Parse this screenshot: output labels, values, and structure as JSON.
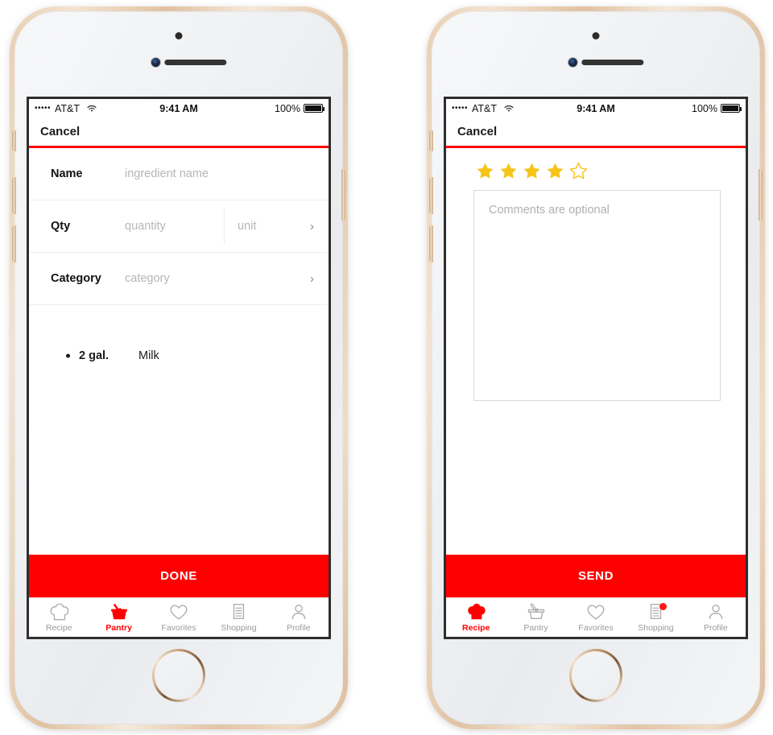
{
  "theme": {
    "accent": "#ff0000",
    "star_color": "#f5c518",
    "muted_text": "#9a9a9a",
    "placeholder": "#b6b6b6"
  },
  "status_bar": {
    "signal_dots": "•••••",
    "carrier": "AT&T",
    "wifi_icon": "wifi-icon",
    "time": "9:41 AM",
    "battery_percent": "100%",
    "battery_icon": "battery-full-icon"
  },
  "phones": [
    {
      "id": "add-ingredient",
      "nav": {
        "cancel_label": "Cancel"
      },
      "form": {
        "rows": [
          {
            "label": "Name",
            "placeholder": "ingredient name",
            "has_chevron": false,
            "split": null
          },
          {
            "label": "Qty",
            "placeholder": "quantity",
            "has_chevron": true,
            "split": {
              "placeholder": "unit"
            }
          },
          {
            "label": "Category",
            "placeholder": "category",
            "has_chevron": true,
            "split": null
          }
        ],
        "chevron_glyph": "›"
      },
      "ingredients": [
        {
          "qty": "2 gal.",
          "name": "Milk"
        }
      ],
      "cta_label": "DONE",
      "tabs": [
        {
          "label": "Recipe",
          "icon": "chef-hat-icon",
          "active": false,
          "badge": false
        },
        {
          "label": "Pantry",
          "icon": "basket-icon",
          "active": true,
          "badge": false
        },
        {
          "label": "Favorites",
          "icon": "heart-icon",
          "active": false,
          "badge": false
        },
        {
          "label": "Shopping",
          "icon": "list-icon",
          "active": false,
          "badge": false
        },
        {
          "label": "Profile",
          "icon": "person-icon",
          "active": false,
          "badge": false
        }
      ]
    },
    {
      "id": "rate-recipe",
      "nav": {
        "cancel_label": "Cancel"
      },
      "rating": {
        "value": 4,
        "max": 5
      },
      "comments": {
        "value": "",
        "placeholder": "Comments are optional"
      },
      "cta_label": "SEND",
      "tabs": [
        {
          "label": "Recipe",
          "icon": "chef-hat-icon",
          "active": true,
          "badge": false
        },
        {
          "label": "Pantry",
          "icon": "basket-icon",
          "active": false,
          "badge": false
        },
        {
          "label": "Favorites",
          "icon": "heart-icon",
          "active": false,
          "badge": false
        },
        {
          "label": "Shopping",
          "icon": "list-icon",
          "active": false,
          "badge": true
        },
        {
          "label": "Profile",
          "icon": "person-icon",
          "active": false,
          "badge": false
        }
      ]
    }
  ]
}
